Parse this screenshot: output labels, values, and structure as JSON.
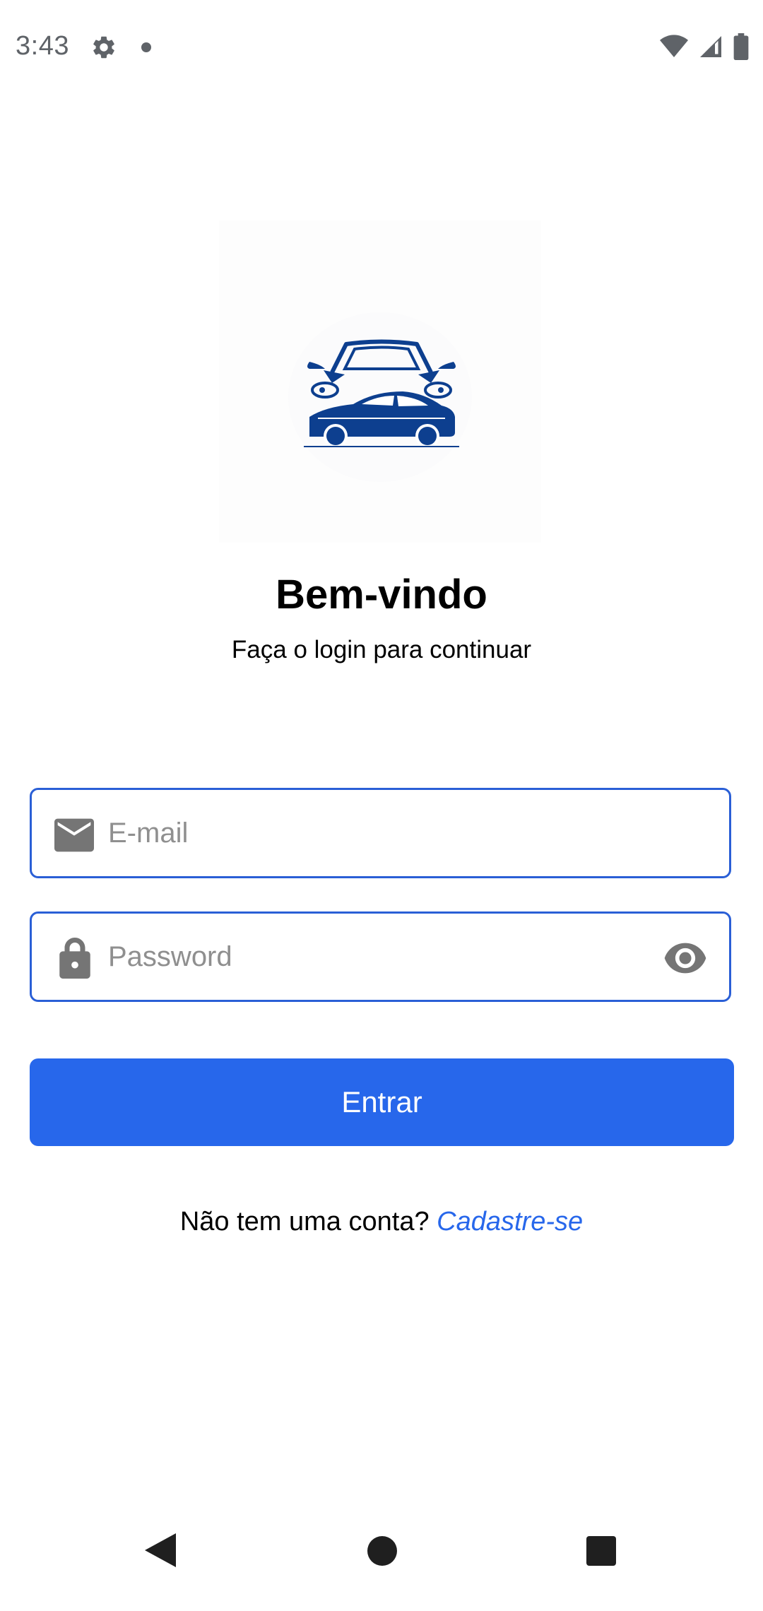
{
  "status_bar": {
    "time": "3:43",
    "icons": [
      "gear-icon",
      "notification-dot",
      "wifi-icon",
      "signal-icon",
      "battery-icon"
    ]
  },
  "header": {
    "title": "Bem-vindo",
    "subtitle": "Faça o login para continuar"
  },
  "form": {
    "email_placeholder": "E-mail",
    "email_value": "",
    "password_placeholder": "Password",
    "password_value": "",
    "submit_label": "Entrar"
  },
  "signup": {
    "prompt": "Não tem uma conta?",
    "link_label": "Cadastre-se"
  },
  "colors": {
    "accent": "#2767eb",
    "input_border": "#2a5fd6",
    "logo_blue": "#0d3f8f",
    "icon_gray": "#757575"
  }
}
